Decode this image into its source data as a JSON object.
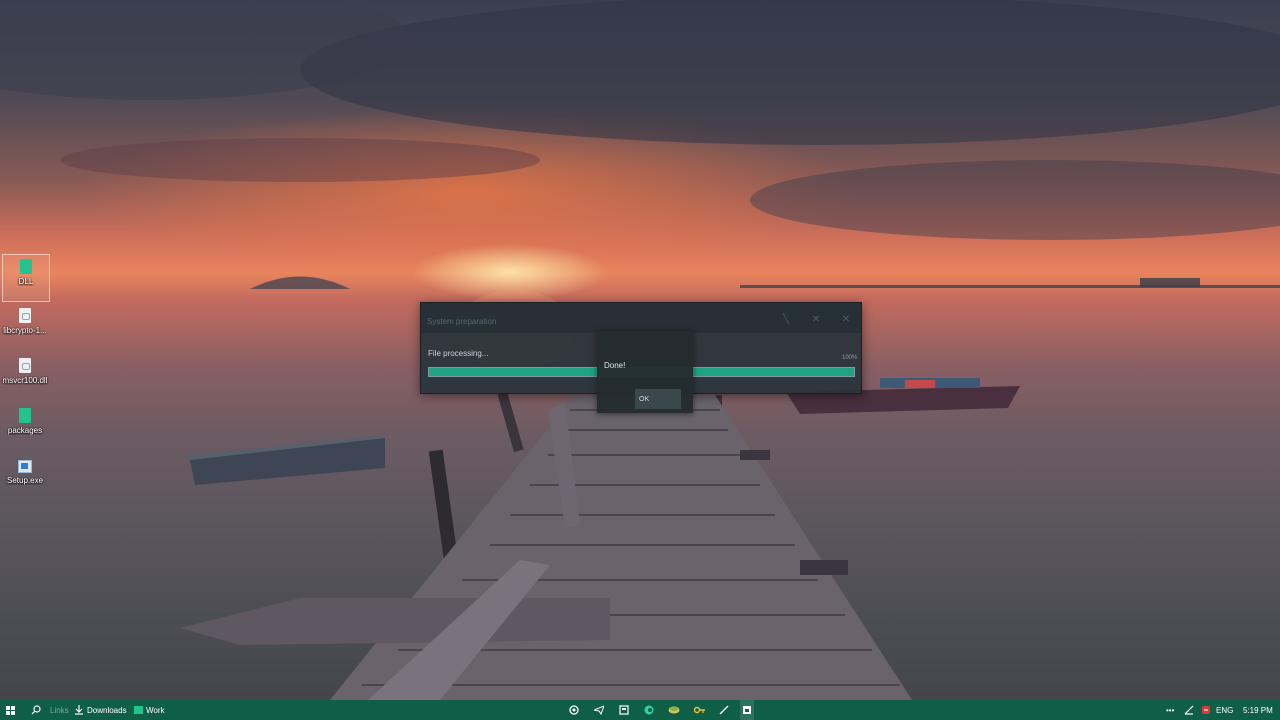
{
  "desktop": {
    "icons": [
      {
        "label": "DLL",
        "type": "folder",
        "selected": true
      },
      {
        "label": "libcrypto-1...",
        "type": "file"
      },
      {
        "label": "msvcr100.dll",
        "type": "file"
      },
      {
        "label": "packages",
        "type": "folder"
      },
      {
        "label": "Setup.exe",
        "type": "exe"
      }
    ]
  },
  "dialog": {
    "title": "System preparation",
    "message": "File processing...",
    "percent_label": "100%",
    "progress": 1.0,
    "controls": [
      "minimize-icon",
      "maximize-icon",
      "close-icon"
    ]
  },
  "popup": {
    "message": "Done!",
    "ok_label": "OK"
  },
  "taskbar": {
    "links_label": "Links",
    "downloads_label": "Downloads",
    "work_label": "Work",
    "pinned_apps": [
      "chromium-icon",
      "telegram-icon",
      "notepad-app-icon",
      "edge-icon",
      "stack-icon",
      "key-icon",
      "pen-icon",
      "window-app-icon"
    ],
    "tray": {
      "overflow_label": "•••",
      "language": "ENG",
      "time": "5:19 PM"
    }
  },
  "colors": {
    "taskbar": "#0f5f46",
    "accent": "#1fa383",
    "dialog_bg": "#2a343a"
  }
}
